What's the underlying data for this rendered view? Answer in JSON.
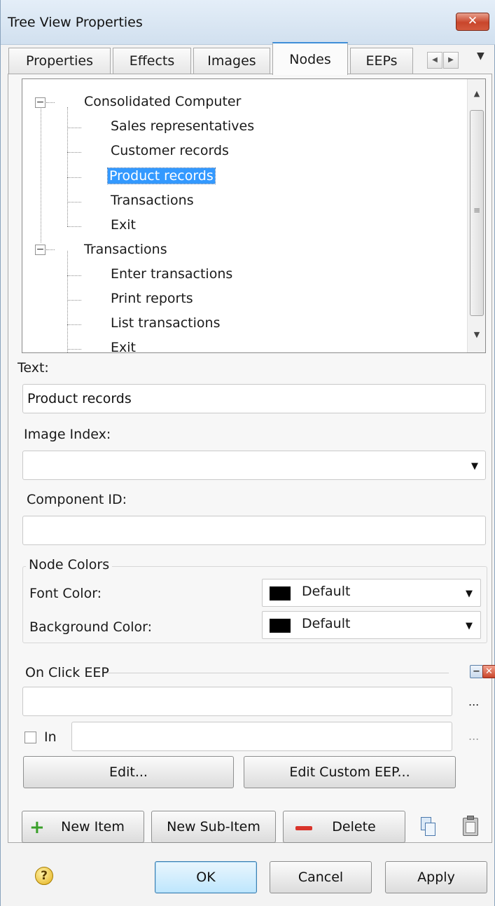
{
  "window": {
    "title": "Tree View Properties",
    "close_label": "✕"
  },
  "tabs": [
    {
      "label": "Properties",
      "active": false
    },
    {
      "label": "Effects",
      "active": false
    },
    {
      "label": "Images",
      "active": false
    },
    {
      "label": "Nodes",
      "active": true
    },
    {
      "label": "EEPs",
      "active": false
    }
  ],
  "tab_scroll": {
    "left_icon": "chevron-left-icon",
    "right_icon": "chevron-right-icon",
    "menu_icon": "dropdown-arrow-icon"
  },
  "tree": {
    "items": [
      {
        "label": "Consolidated Computer",
        "level": 0,
        "expanded": true
      },
      {
        "label": "Sales representatives",
        "level": 1
      },
      {
        "label": "Customer records",
        "level": 1
      },
      {
        "label": "Product records",
        "level": 1,
        "selected": true
      },
      {
        "label": "Transactions",
        "level": 1
      },
      {
        "label": "Exit",
        "level": 1
      },
      {
        "label": "Transactions",
        "level": 0,
        "expanded": true
      },
      {
        "label": "Enter transactions",
        "level": 1
      },
      {
        "label": "Print reports",
        "level": 1
      },
      {
        "label": "List transactions",
        "level": 1
      },
      {
        "label": "Exit",
        "level": 1
      }
    ]
  },
  "text_field": {
    "label": "Text:",
    "value": "Product records"
  },
  "image_index": {
    "label": "Image Index:",
    "value": ""
  },
  "component_id": {
    "label": "Component ID:",
    "value": ""
  },
  "node_colors": {
    "title": "Node Colors",
    "font_color": {
      "label": "Font Color:",
      "value": "Default",
      "swatch": "#000000"
    },
    "background_color": {
      "label": "Background Color:",
      "value": "Default",
      "swatch": "#000000"
    }
  },
  "on_click": {
    "title": "On Click EEP",
    "eep_value": "",
    "ellipsis": "...",
    "in_label": "In",
    "in_checked": false,
    "in_value": "",
    "edit_label": "Edit...",
    "edit_custom_label": "Edit Custom EEP..."
  },
  "item_buttons": {
    "new_item": "New Item",
    "new_sub_item": "New Sub-Item",
    "delete": "Delete"
  },
  "dialog_buttons": {
    "ok": "OK",
    "cancel": "Cancel",
    "apply": "Apply"
  },
  "colors": {
    "selection": "#3399ff",
    "active_tab_accent": "#3f8ed8",
    "close_button": "#c9452b",
    "add_icon": "#3aa02a",
    "delete_icon": "#d9342b"
  }
}
